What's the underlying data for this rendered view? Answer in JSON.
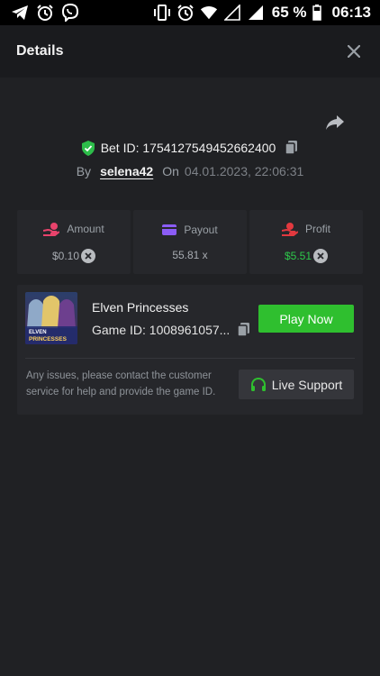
{
  "status_bar": {
    "left_icons": [
      "telegram-icon",
      "alarm-icon",
      "viber-icon"
    ],
    "right_icons": [
      "vibrate-icon",
      "alarm-icon",
      "wifi-icon",
      "signal-empty-icon",
      "signal-full-icon",
      "battery-icon"
    ],
    "battery_percent": "65 %",
    "time": "06:13"
  },
  "header": {
    "title": "Details",
    "close_icon": "close-icon"
  },
  "bet": {
    "share_icon": "share-icon",
    "id_label": "Bet ID: 1754127549452662400",
    "by_label": "By",
    "username": "selena42",
    "on_label": "On",
    "datetime": "04.01.2023, 22:06:31"
  },
  "stats": [
    {
      "label": "Amount",
      "value": "$0.10",
      "icon": "hand-coins-icon",
      "icon_color": "#e8436c"
    },
    {
      "label": "Payout",
      "value": "55.81 x",
      "icon": "card-icon",
      "icon_color": "#8b5cf6"
    },
    {
      "label": "Profit",
      "value": "$5.51",
      "icon": "hand-money-icon",
      "icon_color": "#e2393f"
    }
  ],
  "game": {
    "title": "Elven Princesses",
    "id_label": "Game ID: 1008961057...",
    "play_label": "Play Now",
    "thumb_text_1": "ELVEN",
    "thumb_text_2": "PRINCESSES"
  },
  "support": {
    "message": "Any issues, please contact the customer service for help and provide the game ID.",
    "button_label": "Live Support"
  },
  "colors": {
    "background": "#202124",
    "header": "#1a1b1e",
    "card": "#26272b",
    "accent_green": "#2fbf2f",
    "profit_green": "#2dc94b",
    "shield_green": "#2dbd4a"
  }
}
